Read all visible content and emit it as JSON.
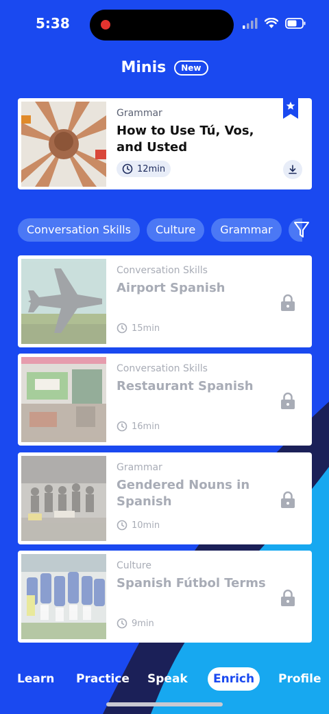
{
  "status_bar": {
    "time": "5:38"
  },
  "header": {
    "title": "Minis",
    "badge": "New"
  },
  "featured": {
    "category": "Grammar",
    "title": "How to Use Tú, Vos, and Usted",
    "duration": "12min"
  },
  "filters": [
    "Conversation Skills",
    "Culture",
    "Grammar"
  ],
  "lessons": [
    {
      "category": "Conversation Skills",
      "title": "Airport Spanish",
      "duration": "15min"
    },
    {
      "category": "Conversation Skills",
      "title": "Restaurant Spanish",
      "duration": "16min"
    },
    {
      "category": "Grammar",
      "title": "Gendered Nouns in Spanish",
      "duration": "10min"
    },
    {
      "category": "Culture",
      "title": "Spanish Fútbol Terms",
      "duration": "9min"
    }
  ],
  "tabs": [
    {
      "label": "Learn"
    },
    {
      "label": "Practice"
    },
    {
      "label": "Speak"
    },
    {
      "label": "Enrich",
      "active": true
    },
    {
      "label": "Profile"
    }
  ],
  "icons": {
    "featured_thumb": "hands-stack-photo",
    "lesson_thumbs": [
      "airplane-photo",
      "restaurant-photo",
      "group-photo",
      "soccer-team-photo"
    ]
  },
  "colors": {
    "background": "#1a49f0",
    "dark_wave": "#1b2058",
    "light_wave": "#17a8f0",
    "chip": "#4b78f5"
  }
}
